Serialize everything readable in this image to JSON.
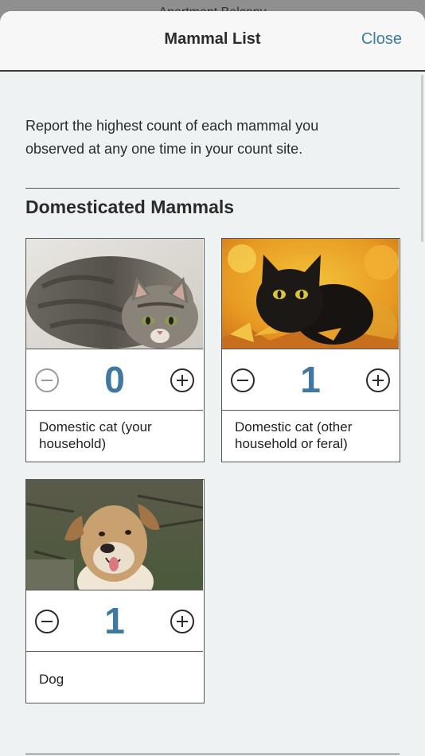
{
  "behind_title": "Apartment Balcony",
  "header": {
    "title": "Mammal List",
    "close_label": "Close"
  },
  "intro_text": "Report the highest count of each mammal you observed at any one time in your count site.",
  "section": {
    "title": "Domesticated Mammals"
  },
  "colors": {
    "accent": "#3f78a0",
    "link": "#3b7ea1",
    "background": "#eef2f2"
  },
  "mammals": [
    {
      "name": "Domestic cat (your household)",
      "count": "0",
      "photo_icon": "tabby-cat-photo",
      "decrement_enabled": false
    },
    {
      "name": "Domestic cat (other household or feral)",
      "count": "1",
      "photo_icon": "black-cat-photo",
      "decrement_enabled": true
    },
    {
      "name": "Dog",
      "count": "1",
      "photo_icon": "dog-photo",
      "decrement_enabled": true
    }
  ]
}
